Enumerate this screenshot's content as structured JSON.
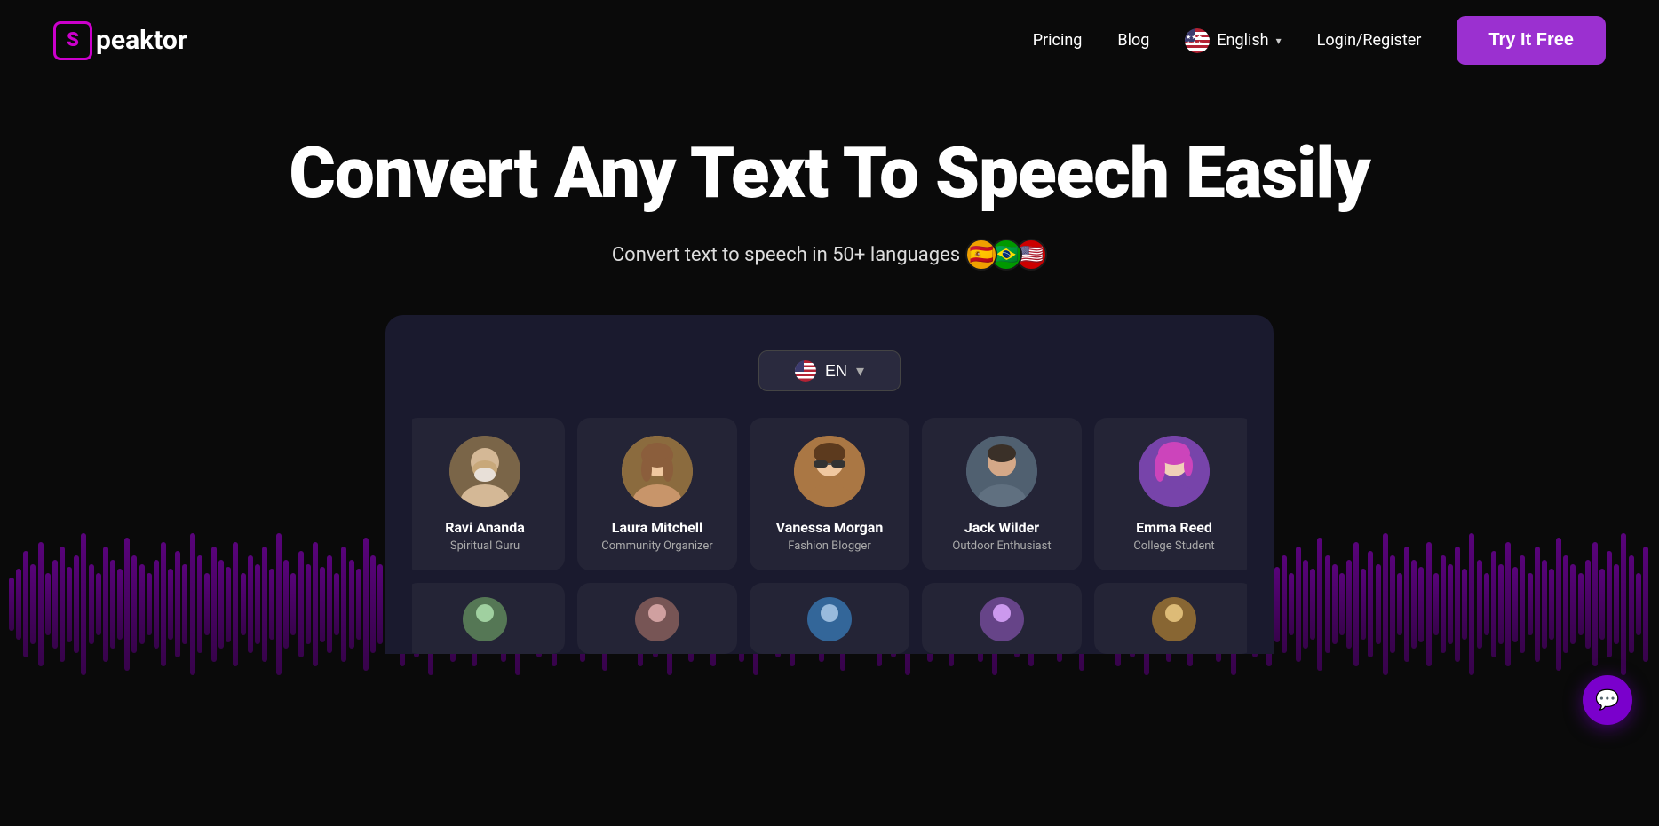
{
  "logo": {
    "letter": "S",
    "name": "peaktor"
  },
  "nav": {
    "pricing": "Pricing",
    "blog": "Blog",
    "language": "English",
    "login": "Login/Register",
    "cta": "Try It Free"
  },
  "hero": {
    "title": "Convert Any Text To Speech Easily",
    "subtitle": "Convert text to speech in 50+ languages",
    "flags": [
      "🇪🇸",
      "🇧🇷",
      "🇺🇸"
    ]
  },
  "app": {
    "lang_selector": "EN",
    "voices": [
      {
        "name": "Ravi Ananda",
        "role": "Spiritual Guru",
        "emoji": "🧙"
      },
      {
        "name": "Laura Mitchell",
        "role": "Community Organizer",
        "emoji": "👩"
      },
      {
        "name": "Vanessa Morgan",
        "role": "Fashion Blogger",
        "emoji": "👩‍🦱"
      },
      {
        "name": "Jack Wilder",
        "role": "Outdoor Enthusiast",
        "emoji": "👨"
      },
      {
        "name": "Emma Reed",
        "role": "College Student",
        "emoji": "👩‍🦰"
      }
    ]
  },
  "chat": {
    "icon": "💬"
  }
}
